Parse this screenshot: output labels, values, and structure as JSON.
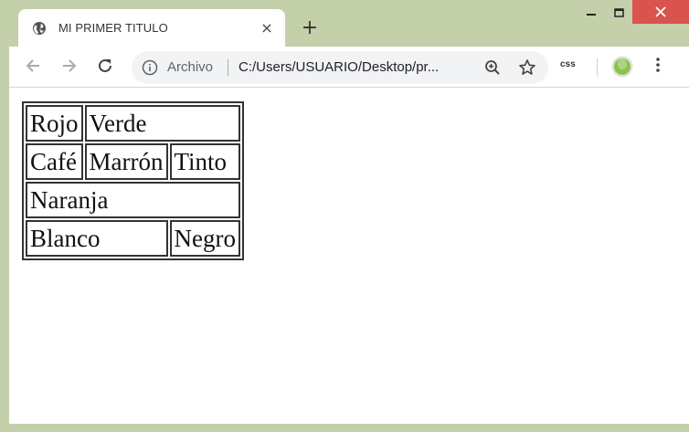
{
  "browser": {
    "tab": {
      "title": "MI PRIMER TITULO",
      "close": "×"
    },
    "new_tab": "+",
    "window_controls": {
      "minimize": "minimize-icon",
      "maximize": "maximize-icon",
      "close": "close-icon",
      "close_color": "#d9534f"
    },
    "omnibox": {
      "label": "Archivo",
      "url": "C:/Users/USUARIO/Desktop/pr..."
    },
    "extension": {
      "label": "css"
    },
    "frame_color": "#c3d0a9",
    "profile_color": "#8bc34a"
  },
  "page": {
    "table": {
      "rows": [
        [
          {
            "text": "Rojo",
            "colspan": 1
          },
          {
            "text": "Verde",
            "colspan": 2
          }
        ],
        [
          {
            "text": "Café",
            "colspan": 1
          },
          {
            "text": "Marrón",
            "colspan": 1
          },
          {
            "text": "Tinto",
            "colspan": 1
          }
        ],
        [
          {
            "text": "Naranja",
            "colspan": 3
          }
        ],
        [
          {
            "text": "Blanco",
            "colspan": 2
          },
          {
            "text": "Negro",
            "colspan": 1
          }
        ]
      ]
    }
  }
}
